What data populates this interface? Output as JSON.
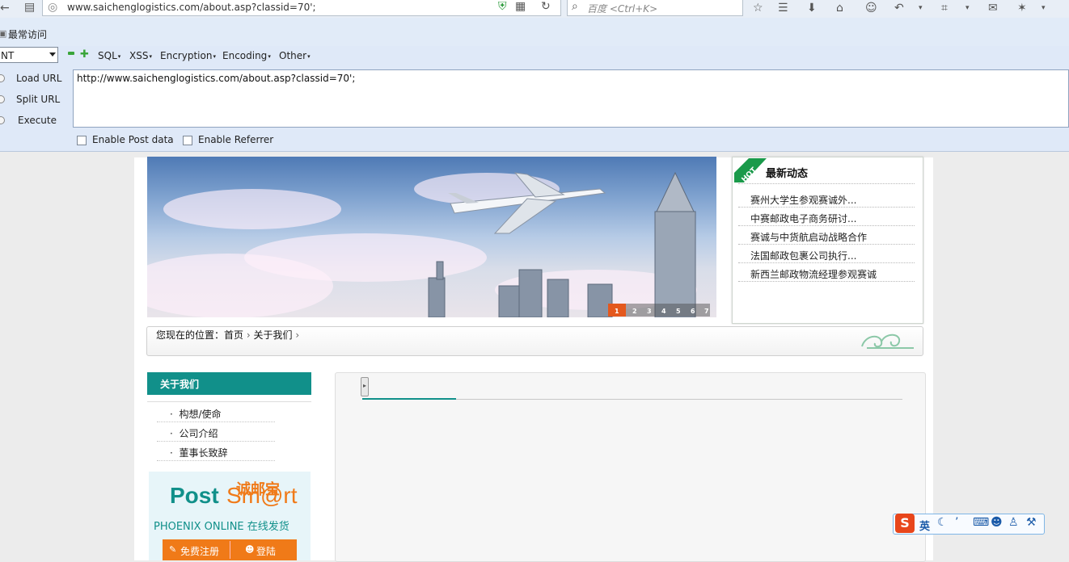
{
  "browser": {
    "url": "www.saichenglogistics.com/about.asp?classid=70';",
    "search_placeholder": "百度 <Ctrl+K>",
    "bookmark": "最常访问"
  },
  "hackbar": {
    "select_value": "NT",
    "menus": [
      "SQL",
      "XSS",
      "Encryption",
      "Encoding",
      "Other"
    ],
    "load_url": "Load URL",
    "split_url": "Split URL",
    "execute": "Execute",
    "url_value": "http://www.saichenglogistics.com/about.asp?classid=70';",
    "enable_post": "Enable Post data",
    "enable_referrer": "Enable Referrer"
  },
  "banner": {
    "slides": [
      "1",
      "2",
      "3",
      "4",
      "5",
      "6",
      "7"
    ]
  },
  "news": {
    "title": "最新动态",
    "hot_badge": "HOT",
    "items": [
      "赛州大学生参观赛诚外...",
      "中赛邮政电子商务研讨...",
      "赛诚与中货航启动战略合作",
      "法国邮政包裹公司执行...",
      "新西兰邮政物流经理参观赛诚"
    ]
  },
  "breadcrumb": {
    "prefix": "您现在的位置：",
    "home": "首页",
    "current": "关于我们"
  },
  "sidebar": {
    "title": "关于我们",
    "items": [
      "构想/使命",
      "公司介绍",
      "董事长致辞"
    ]
  },
  "ad": {
    "brand_cn": "诚邮宝",
    "brand_post": "Post",
    "brand_smart": "Sm@rt",
    "subtitle": "PHOENIX ONLINE 在线发货",
    "register": "免费注册",
    "login": "登陆"
  },
  "ime": {
    "lang": "英"
  },
  "colors": {
    "teal": "#11908a",
    "hackbar_bg": "#dfe9f8",
    "ad_orange": "#f07a18"
  }
}
